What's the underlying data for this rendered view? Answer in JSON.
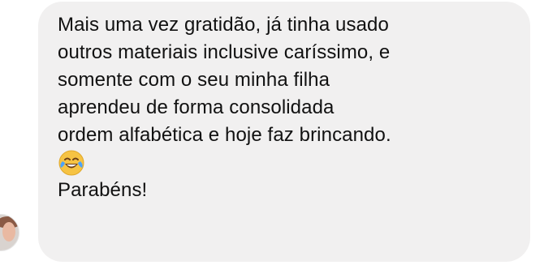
{
  "message": {
    "text_main": "Mais uma vez gratidão, já tinha usado\noutros materiais inclusive caríssimo, e\nsomente com o seu minha filha\naprendeu de forma consolidada\nordem alfabética e hoje faz brincando.",
    "emoji_icon": "face-with-tears-of-joy-icon",
    "text_end": "Parabéns!"
  }
}
